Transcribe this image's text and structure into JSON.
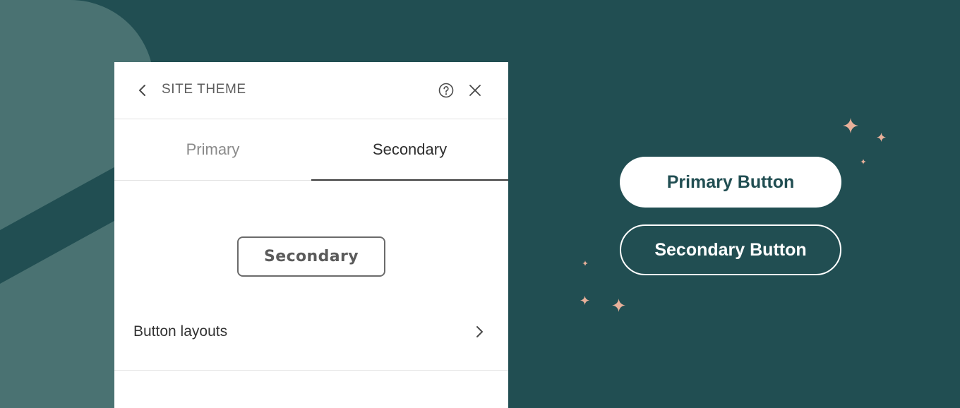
{
  "colors": {
    "background": "#214e52",
    "decor_shape": "#4a7272",
    "panel": "#ffffff",
    "sparkle": "#e8b09a"
  },
  "panel": {
    "back_icon": "chevron-left-icon",
    "title": "SITE THEME",
    "help_icon": "question-circle-icon",
    "close_icon": "close-icon",
    "tabs": [
      {
        "label": "Primary",
        "selected": false
      },
      {
        "label": "Secondary",
        "selected": true
      }
    ],
    "preview_button_label": "Secondary",
    "layouts_row": {
      "label": "Button layouts",
      "icon": "chevron-right-icon"
    }
  },
  "showcase": {
    "primary_button_label": "Primary Button",
    "secondary_button_label": "Secondary Button"
  }
}
